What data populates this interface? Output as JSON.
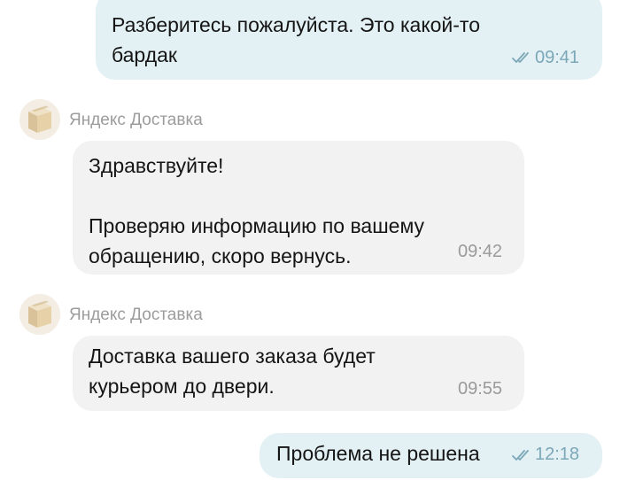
{
  "messages": [
    {
      "direction": "outgoing",
      "text": "Разберитесь пожалуйста. Это какой-то\nбардак",
      "time": "09:41",
      "status_icon": "double-check-icon"
    },
    {
      "direction": "incoming",
      "sender": "Яндекс Доставка",
      "avatar_icon": "box-icon",
      "text": "Здравствуйте!\n\nПроверяю информацию по вашему\nобращению, скоро вернусь.",
      "time": "09:42"
    },
    {
      "direction": "incoming",
      "sender": "Яндекс Доставка",
      "avatar_icon": "box-icon",
      "text": "Доставка вашего заказа будет\nкурьером до двери.",
      "time": "09:55"
    },
    {
      "direction": "outgoing",
      "text": "Проблема не решена",
      "time": "12:18",
      "status_icon": "double-check-icon"
    }
  ],
  "colors": {
    "outgoing_bubble": "#e3f1f4",
    "incoming_bubble": "#f2f2f2",
    "outgoing_time": "#7ba7b8",
    "incoming_time": "#9a9a9a",
    "sender_name": "#9c9c9c"
  }
}
